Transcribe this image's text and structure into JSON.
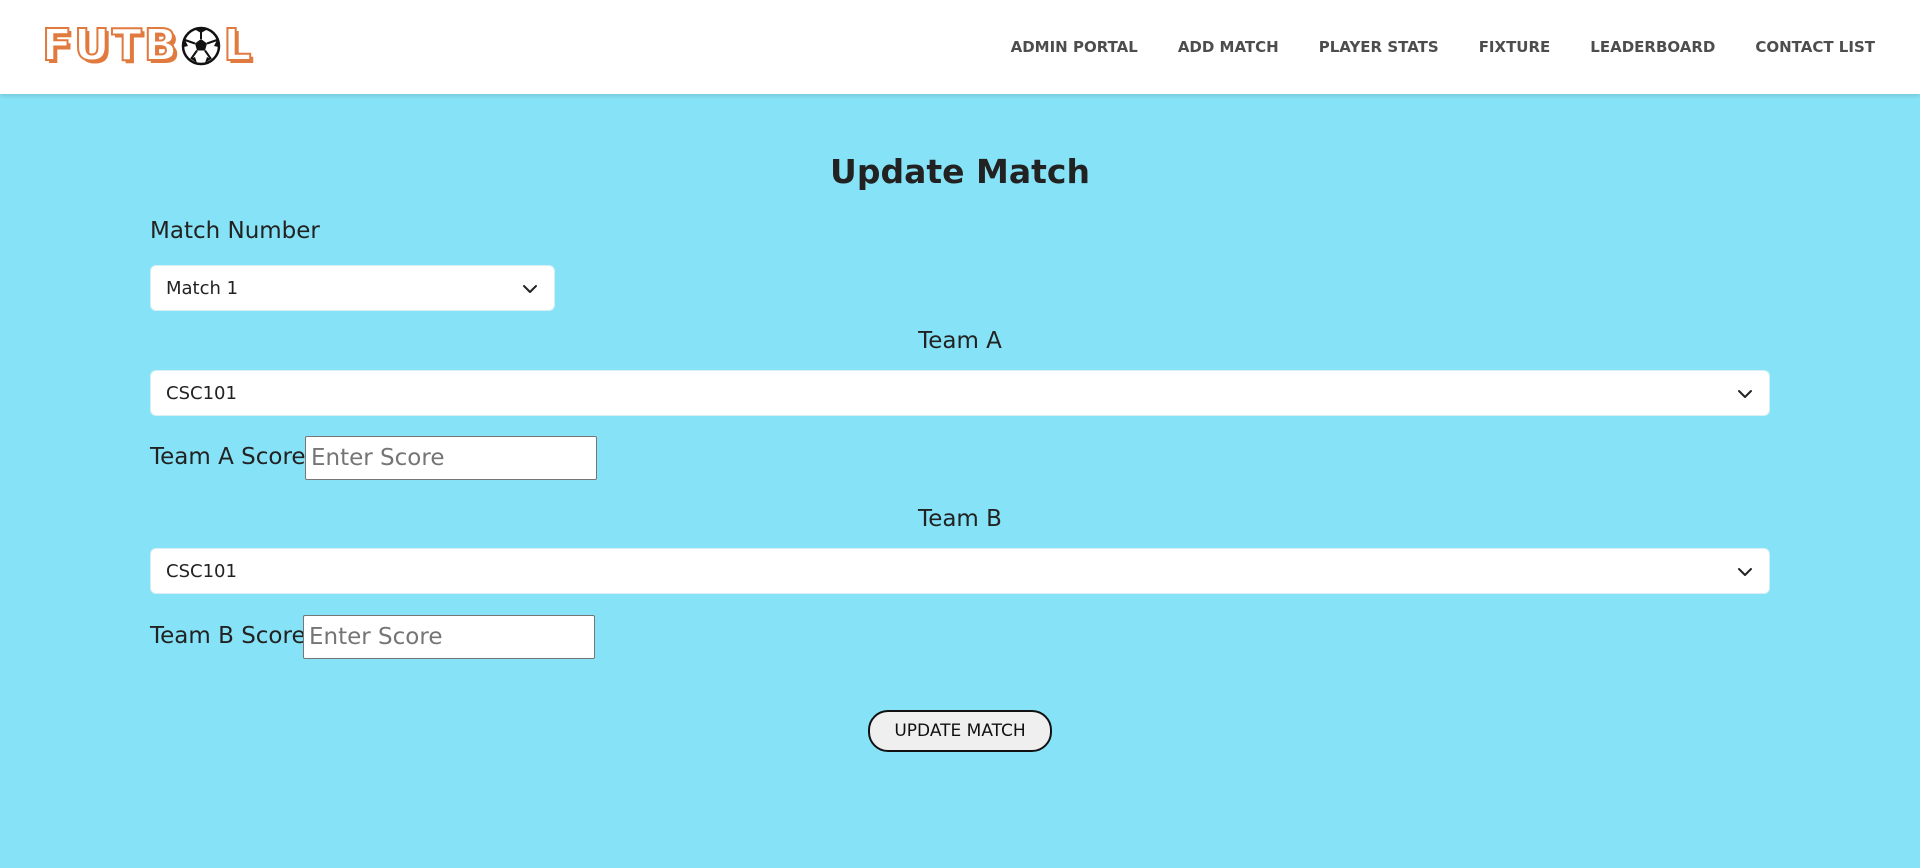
{
  "brand": {
    "logo_text_left": "FUTB",
    "logo_text_right": "L",
    "logo_icon": "soccer-ball-icon",
    "accent_color": "#e07a3e"
  },
  "nav": {
    "items": [
      {
        "label": "ADMIN PORTAL"
      },
      {
        "label": "ADD MATCH"
      },
      {
        "label": "PLAYER STATS"
      },
      {
        "label": "FIXTURE"
      },
      {
        "label": "LEADERBOARD"
      },
      {
        "label": "CONTACT LIST"
      }
    ]
  },
  "form": {
    "title": "Update Match",
    "match_number_label": "Match Number",
    "match_number_value": "Match 1",
    "team_a_label": "Team A",
    "team_a_value": "CSC101",
    "team_a_score_label": "Team A Score",
    "team_a_score_placeholder": "Enter Score",
    "team_b_label": "Team B",
    "team_b_value": "CSC101",
    "team_b_score_label": "Team B Score",
    "team_b_score_placeholder": "Enter Score",
    "submit_label": "UPDATE MATCH"
  },
  "colors": {
    "background": "#86e3f7",
    "navbar": "#ffffff"
  }
}
